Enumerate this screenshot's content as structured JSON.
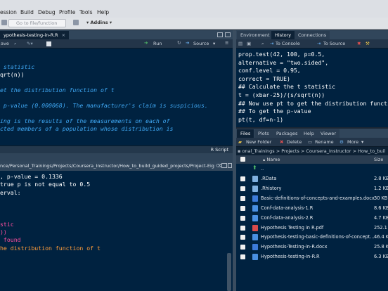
{
  "menubar": {
    "items": [
      "ession",
      "Build",
      "Debug",
      "Profile",
      "Tools",
      "Help"
    ]
  },
  "toolbar": {
    "goto_placeholder": "Go to file/function",
    "addins": "Addins"
  },
  "source": {
    "tab": "ypothesis-testing-in-R.R",
    "save": "ave",
    "run": "Run",
    "source_btn": "Source",
    "lines": [
      {
        "text": " statistic",
        "cls": "cmt"
      },
      {
        "text": "qrt(n))",
        "cls": "plain"
      },
      {
        "text": "",
        "cls": "plain"
      },
      {
        "text": "et the distribution function of t",
        "cls": "cmt"
      },
      {
        "text": "",
        "cls": "plain"
      },
      {
        "text": " p-value (0.000068). The manufacturer's claim is suspicious.",
        "cls": "cmt"
      },
      {
        "text": "",
        "cls": "plain"
      },
      {
        "text": "ing is the results of the measurements on each of",
        "cls": "cmt"
      },
      {
        "text": "cted members of a population whose distribution is",
        "cls": "cmt"
      }
    ],
    "filetype": "R Script"
  },
  "console": {
    "path": "nce/Personal_Trainings/Projects/Coursera_Instructor/How_to_build_guided_projects/Project-Eight/",
    "lines": [
      {
        "text": ", p-value = 0.1336",
        "cls": "out"
      },
      {
        "text": "true p is not equal to 0.5",
        "cls": "out"
      },
      {
        "text": "erval:",
        "cls": "out"
      },
      {
        "text": "",
        "cls": "out"
      },
      {
        "text": "",
        "cls": "out"
      },
      {
        "text": "",
        "cls": "out"
      },
      {
        "text": "stic",
        "cls": "pink"
      },
      {
        "text": "))",
        "cls": "pink"
      },
      {
        "text": " found",
        "cls": "pink"
      },
      {
        "text": "he distribution function of t",
        "cls": "orange"
      }
    ]
  },
  "history": {
    "tabs": [
      "Environment",
      "History",
      "Connections"
    ],
    "to_console": "To Console",
    "to_source": "To Source",
    "lines": [
      "prop.test(42, 100, p=0.5,",
      "alternative = \"two.sided\",",
      "conf.level = 0.95,",
      "correct = TRUE)",
      "## Calculate the t statistic",
      "t = (xbar-25)/(s/sqrt(n))",
      "## Now use pt to get the distribution function",
      "## To get the p-value",
      "pt(t, df=n-1)"
    ]
  },
  "files": {
    "tabs": [
      "Files",
      "Plots",
      "Packages",
      "Help",
      "Viewer"
    ],
    "new_folder": "New Folder",
    "delete": "Delete",
    "rename": "Rename",
    "more": "More",
    "breadcrumb": "onal_Trainings > Projects > Coursera_Instructor > How_to_buil",
    "col_name": "Name",
    "col_size": "Size",
    "up": "..",
    "rows": [
      {
        "name": ".RData",
        "size": "2.8 KB",
        "color": "#7fb0e0"
      },
      {
        "name": ".Rhistory",
        "size": "1.2 KB",
        "color": "#7fb0e0"
      },
      {
        "name": "Basic-definitions-of-concepts-and-examples.docx",
        "size": "30 KB",
        "color": "#3d7bd9"
      },
      {
        "name": "Conf-data-analysis-1.R",
        "size": "8.6 KB",
        "color": "#4a90e2"
      },
      {
        "name": "Conf-data-analysis-2.R",
        "size": "4.7 KB",
        "color": "#4a90e2"
      },
      {
        "name": "Hypothesis Testing in R.pdf",
        "size": "252.1",
        "color": "#d94b4b"
      },
      {
        "name": "Hypothesis-testing-basic-definitions-of-concept...",
        "size": "46.4 K",
        "color": "#4a90e2"
      },
      {
        "name": "Hypothesis-Testing-in-R.docx",
        "size": "25.8 K",
        "color": "#3d7bd9"
      },
      {
        "name": "Hypothesis-testing-in-R.R",
        "size": "6.3 KB",
        "color": "#4a90e2"
      }
    ]
  },
  "colors": {
    "editor_bg": "#002240",
    "comment": "#3fa9f5",
    "pink": "#ff4fa0",
    "orange": "#ff9d3a"
  }
}
